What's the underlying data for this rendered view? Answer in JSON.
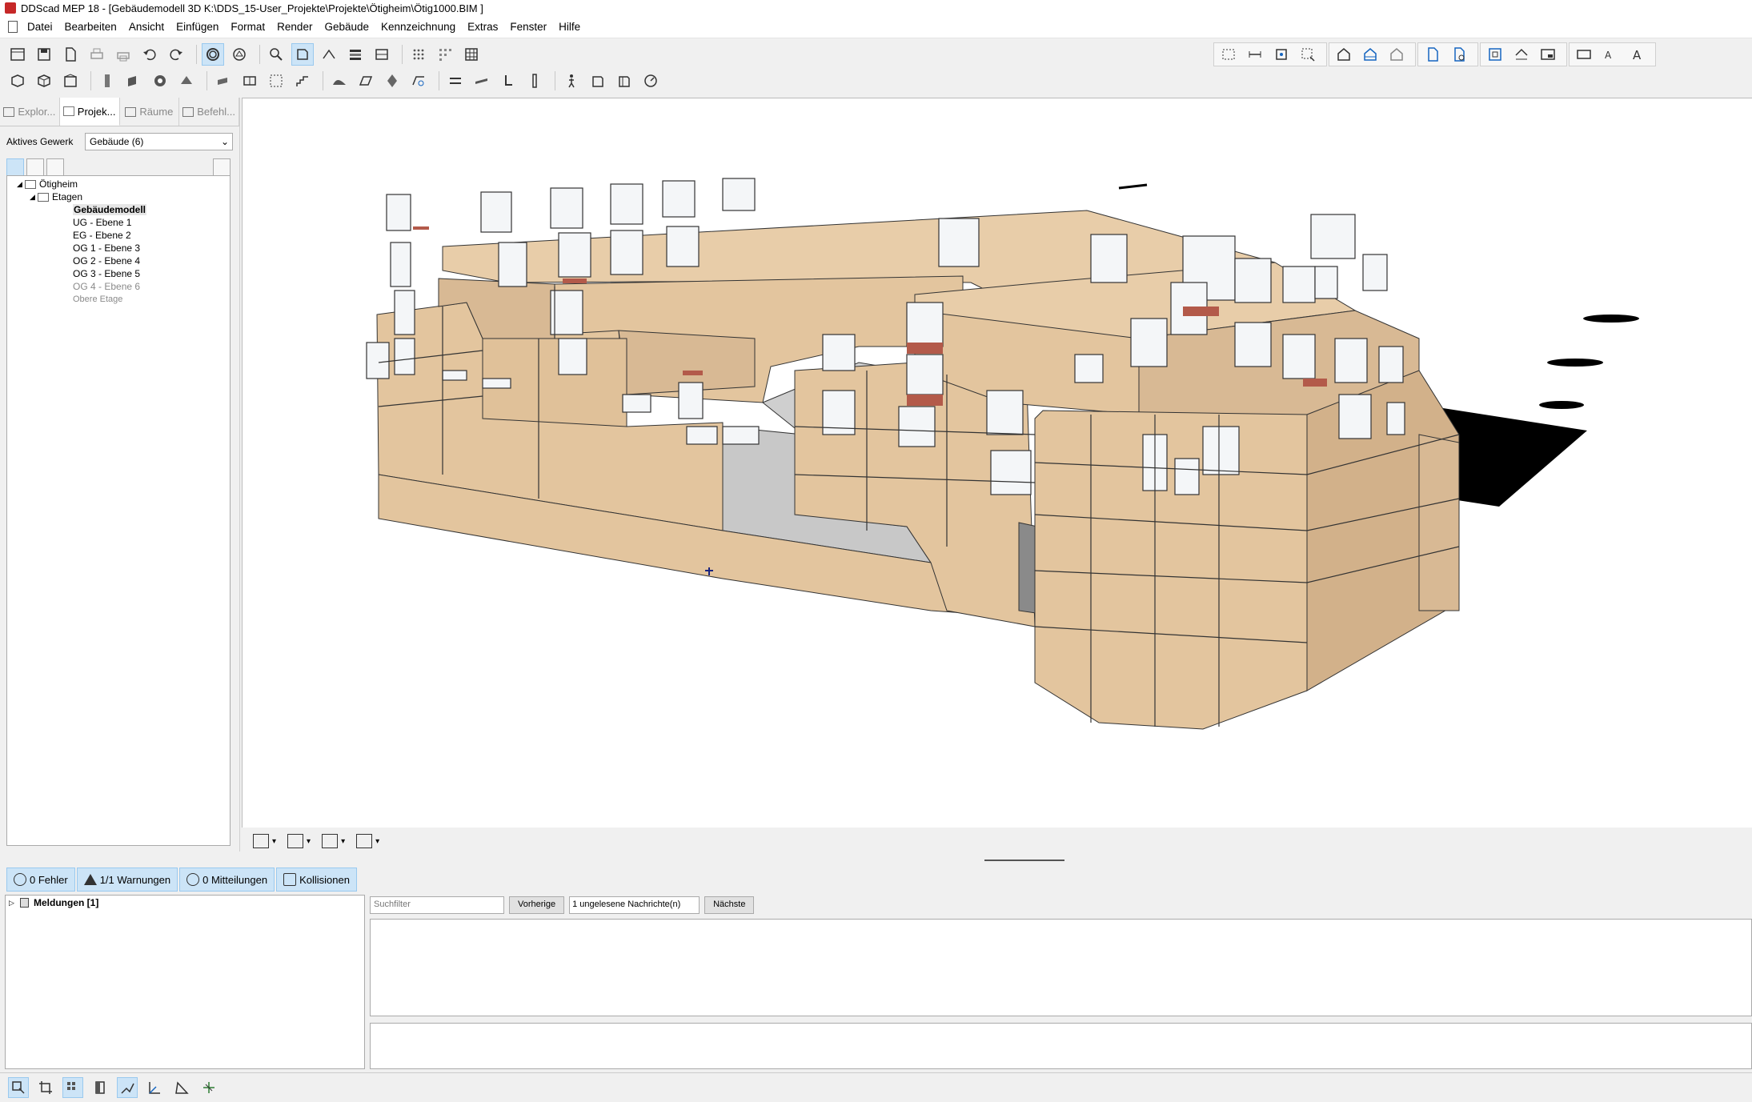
{
  "window": {
    "title": "DDScad MEP 18 - [Gebäudemodell  3D  K:\\DDS_15-User_Projekte\\Projekte\\Ötigheim\\Ötig1000.BIM ]"
  },
  "menu": [
    "Datei",
    "Bearbeiten",
    "Ansicht",
    "Einfügen",
    "Format",
    "Render",
    "Gebäude",
    "Kennzeichnung",
    "Extras",
    "Fenster",
    "Hilfe"
  ],
  "sidebar": {
    "tabs": [
      {
        "label": "Explor...",
        "active": false
      },
      {
        "label": "Projek...",
        "active": true
      },
      {
        "label": "Räume",
        "active": false
      },
      {
        "label": "Befehl...",
        "active": false
      }
    ],
    "active_gewerk_label": "Aktives Gewerk",
    "active_gewerk_value": "Gebäude (6)",
    "tree": {
      "root": "Ötigheim",
      "group": "Etagen",
      "items": [
        {
          "label": "Gebäudemodell",
          "style": "bold"
        },
        {
          "label": "UG - Ebene 1",
          "style": "normal"
        },
        {
          "label": "EG - Ebene 2",
          "style": "normal"
        },
        {
          "label": "OG 1 - Ebene 3",
          "style": "normal"
        },
        {
          "label": "OG 2 - Ebene 4",
          "style": "normal"
        },
        {
          "label": "OG 3 - Ebene 5",
          "style": "normal"
        },
        {
          "label": "OG 4 - Ebene 6",
          "style": "grey"
        },
        {
          "label": "Obere Etage",
          "style": "grey"
        }
      ]
    }
  },
  "messages": {
    "tabs": [
      "0 Fehler",
      "1/1 Warnungen",
      "0 Mitteilungen",
      "Kollisionen"
    ],
    "tree_root": "Meldungen [1]",
    "filter_placeholder": "Suchfilter",
    "prev_button": "Vorherige",
    "unread_info": "1 ungelesene Nachrichte(n)",
    "next_button": "Nächste"
  },
  "colors": {
    "facade": "#e3c59e",
    "facade_dark": "#d2b18a",
    "roof": "#e8cda9",
    "floor": "#c8c8c8",
    "balcony": "#b35a4a",
    "glass": "#f4f6f8",
    "shadow": "#000000",
    "accent": "#cce4f7"
  }
}
